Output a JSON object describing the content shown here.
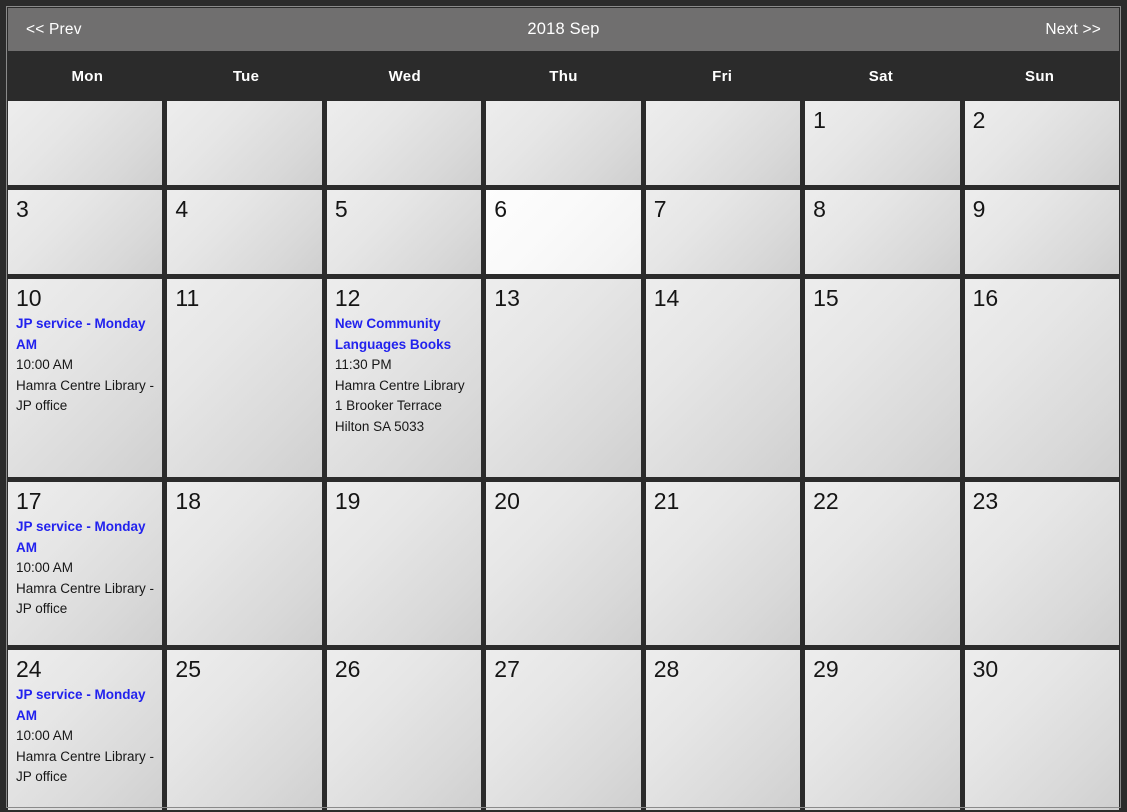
{
  "header": {
    "prev_label": "<< Prev",
    "title": "2018 Sep",
    "next_label": "Next >>"
  },
  "weekdays": [
    "Mon",
    "Tue",
    "Wed",
    "Thu",
    "Fri",
    "Sat",
    "Sun"
  ],
  "colors": {
    "header_bar": "#706f6f",
    "page_background": "#2b2b2b",
    "cell_background": "#e3e3e3",
    "today_background": "#fafafa",
    "event_link": "#2222ee",
    "day_number": "#151515",
    "weekday_text": "#ffffff"
  },
  "weeks": [
    [
      {
        "day": "",
        "blank": true
      },
      {
        "day": "",
        "blank": true
      },
      {
        "day": "",
        "blank": true
      },
      {
        "day": "",
        "blank": true
      },
      {
        "day": "",
        "blank": true
      },
      {
        "day": "1"
      },
      {
        "day": "2"
      }
    ],
    [
      {
        "day": "3"
      },
      {
        "day": "4"
      },
      {
        "day": "5"
      },
      {
        "day": "6",
        "today": true
      },
      {
        "day": "7"
      },
      {
        "day": "8"
      },
      {
        "day": "9"
      }
    ],
    [
      {
        "day": "10",
        "event": {
          "title": "JP service - Monday AM",
          "time": "10:00 AM",
          "location": "Hamra Centre Library - JP office"
        }
      },
      {
        "day": "11"
      },
      {
        "day": "12",
        "event": {
          "title": "New Community Languages Books",
          "time": "11:30 PM",
          "location": "Hamra Centre Library 1 Brooker Terrace Hilton SA 5033"
        }
      },
      {
        "day": "13"
      },
      {
        "day": "14"
      },
      {
        "day": "15"
      },
      {
        "day": "16"
      }
    ],
    [
      {
        "day": "17",
        "event": {
          "title": "JP service - Monday AM",
          "time": "10:00 AM",
          "location": "Hamra Centre Library - JP office"
        }
      },
      {
        "day": "18"
      },
      {
        "day": "19"
      },
      {
        "day": "20"
      },
      {
        "day": "21"
      },
      {
        "day": "22"
      },
      {
        "day": "23"
      }
    ],
    [
      {
        "day": "24",
        "event": {
          "title": "JP service - Monday AM",
          "time": "10:00 AM",
          "location": "Hamra Centre Library - JP office"
        }
      },
      {
        "day": "25"
      },
      {
        "day": "26"
      },
      {
        "day": "27"
      },
      {
        "day": "28"
      },
      {
        "day": "29"
      },
      {
        "day": "30"
      }
    ]
  ]
}
